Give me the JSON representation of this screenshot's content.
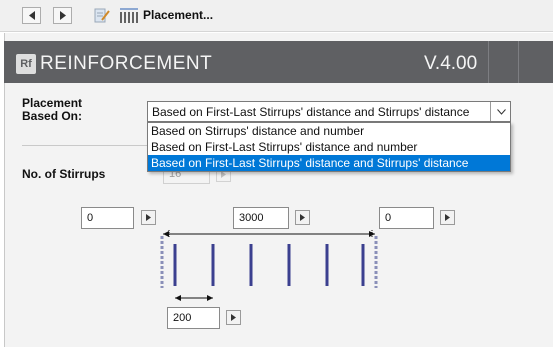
{
  "toolbar": {
    "title": "Placement...",
    "icons": [
      "back-arrow-icon",
      "forward-arrow-icon",
      "edit-document-icon",
      "stirrups-icon"
    ]
  },
  "header": {
    "logo": "Rf",
    "title": "REINFORCEMENT",
    "version": "V.4.00",
    "background": "#5f6063"
  },
  "placement": {
    "label": "Placement\nBased On:",
    "selected": "Based on First-Last Stirrups' distance and Stirrups' distance",
    "options": [
      "Based on Stirrups' distance and number",
      "Based on First-Last Stirrups' distance and number",
      "Based on First-Last Stirrups' distance and Stirrups' distance"
    ],
    "highlight_color": "#0078d7"
  },
  "stirrups": {
    "label": "No. of Stirrups",
    "value": "16"
  },
  "fields": {
    "start_offset": "0",
    "total_length": "3000",
    "end_offset": "0",
    "spacing": "200"
  },
  "diagram": {
    "bar_color": "#3b3f8f"
  }
}
